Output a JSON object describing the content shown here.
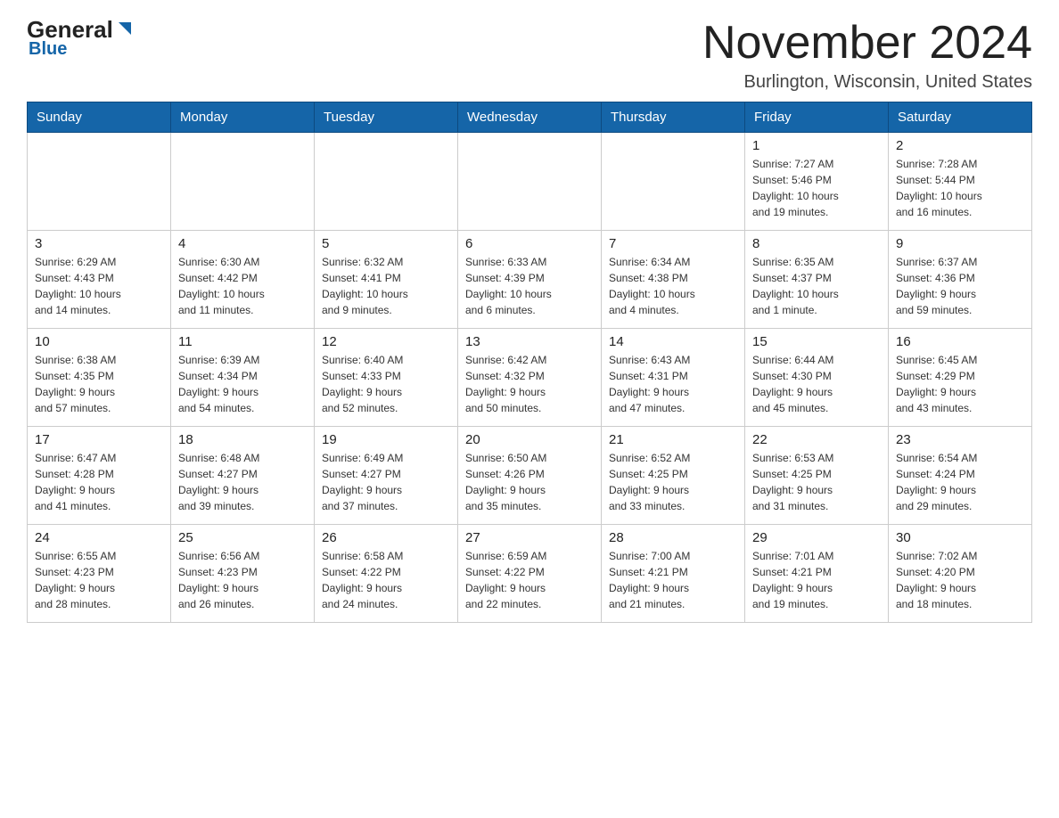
{
  "header": {
    "logo_main": "General",
    "logo_sub": "Blue",
    "month_title": "November 2024",
    "location": "Burlington, Wisconsin, United States"
  },
  "days_of_week": [
    "Sunday",
    "Monday",
    "Tuesday",
    "Wednesday",
    "Thursday",
    "Friday",
    "Saturday"
  ],
  "weeks": [
    [
      {
        "day": "",
        "info": ""
      },
      {
        "day": "",
        "info": ""
      },
      {
        "day": "",
        "info": ""
      },
      {
        "day": "",
        "info": ""
      },
      {
        "day": "",
        "info": ""
      },
      {
        "day": "1",
        "info": "Sunrise: 7:27 AM\nSunset: 5:46 PM\nDaylight: 10 hours\nand 19 minutes."
      },
      {
        "day": "2",
        "info": "Sunrise: 7:28 AM\nSunset: 5:44 PM\nDaylight: 10 hours\nand 16 minutes."
      }
    ],
    [
      {
        "day": "3",
        "info": "Sunrise: 6:29 AM\nSunset: 4:43 PM\nDaylight: 10 hours\nand 14 minutes."
      },
      {
        "day": "4",
        "info": "Sunrise: 6:30 AM\nSunset: 4:42 PM\nDaylight: 10 hours\nand 11 minutes."
      },
      {
        "day": "5",
        "info": "Sunrise: 6:32 AM\nSunset: 4:41 PM\nDaylight: 10 hours\nand 9 minutes."
      },
      {
        "day": "6",
        "info": "Sunrise: 6:33 AM\nSunset: 4:39 PM\nDaylight: 10 hours\nand 6 minutes."
      },
      {
        "day": "7",
        "info": "Sunrise: 6:34 AM\nSunset: 4:38 PM\nDaylight: 10 hours\nand 4 minutes."
      },
      {
        "day": "8",
        "info": "Sunrise: 6:35 AM\nSunset: 4:37 PM\nDaylight: 10 hours\nand 1 minute."
      },
      {
        "day": "9",
        "info": "Sunrise: 6:37 AM\nSunset: 4:36 PM\nDaylight: 9 hours\nand 59 minutes."
      }
    ],
    [
      {
        "day": "10",
        "info": "Sunrise: 6:38 AM\nSunset: 4:35 PM\nDaylight: 9 hours\nand 57 minutes."
      },
      {
        "day": "11",
        "info": "Sunrise: 6:39 AM\nSunset: 4:34 PM\nDaylight: 9 hours\nand 54 minutes."
      },
      {
        "day": "12",
        "info": "Sunrise: 6:40 AM\nSunset: 4:33 PM\nDaylight: 9 hours\nand 52 minutes."
      },
      {
        "day": "13",
        "info": "Sunrise: 6:42 AM\nSunset: 4:32 PM\nDaylight: 9 hours\nand 50 minutes."
      },
      {
        "day": "14",
        "info": "Sunrise: 6:43 AM\nSunset: 4:31 PM\nDaylight: 9 hours\nand 47 minutes."
      },
      {
        "day": "15",
        "info": "Sunrise: 6:44 AM\nSunset: 4:30 PM\nDaylight: 9 hours\nand 45 minutes."
      },
      {
        "day": "16",
        "info": "Sunrise: 6:45 AM\nSunset: 4:29 PM\nDaylight: 9 hours\nand 43 minutes."
      }
    ],
    [
      {
        "day": "17",
        "info": "Sunrise: 6:47 AM\nSunset: 4:28 PM\nDaylight: 9 hours\nand 41 minutes."
      },
      {
        "day": "18",
        "info": "Sunrise: 6:48 AM\nSunset: 4:27 PM\nDaylight: 9 hours\nand 39 minutes."
      },
      {
        "day": "19",
        "info": "Sunrise: 6:49 AM\nSunset: 4:27 PM\nDaylight: 9 hours\nand 37 minutes."
      },
      {
        "day": "20",
        "info": "Sunrise: 6:50 AM\nSunset: 4:26 PM\nDaylight: 9 hours\nand 35 minutes."
      },
      {
        "day": "21",
        "info": "Sunrise: 6:52 AM\nSunset: 4:25 PM\nDaylight: 9 hours\nand 33 minutes."
      },
      {
        "day": "22",
        "info": "Sunrise: 6:53 AM\nSunset: 4:25 PM\nDaylight: 9 hours\nand 31 minutes."
      },
      {
        "day": "23",
        "info": "Sunrise: 6:54 AM\nSunset: 4:24 PM\nDaylight: 9 hours\nand 29 minutes."
      }
    ],
    [
      {
        "day": "24",
        "info": "Sunrise: 6:55 AM\nSunset: 4:23 PM\nDaylight: 9 hours\nand 28 minutes."
      },
      {
        "day": "25",
        "info": "Sunrise: 6:56 AM\nSunset: 4:23 PM\nDaylight: 9 hours\nand 26 minutes."
      },
      {
        "day": "26",
        "info": "Sunrise: 6:58 AM\nSunset: 4:22 PM\nDaylight: 9 hours\nand 24 minutes."
      },
      {
        "day": "27",
        "info": "Sunrise: 6:59 AM\nSunset: 4:22 PM\nDaylight: 9 hours\nand 22 minutes."
      },
      {
        "day": "28",
        "info": "Sunrise: 7:00 AM\nSunset: 4:21 PM\nDaylight: 9 hours\nand 21 minutes."
      },
      {
        "day": "29",
        "info": "Sunrise: 7:01 AM\nSunset: 4:21 PM\nDaylight: 9 hours\nand 19 minutes."
      },
      {
        "day": "30",
        "info": "Sunrise: 7:02 AM\nSunset: 4:20 PM\nDaylight: 9 hours\nand 18 minutes."
      }
    ]
  ]
}
